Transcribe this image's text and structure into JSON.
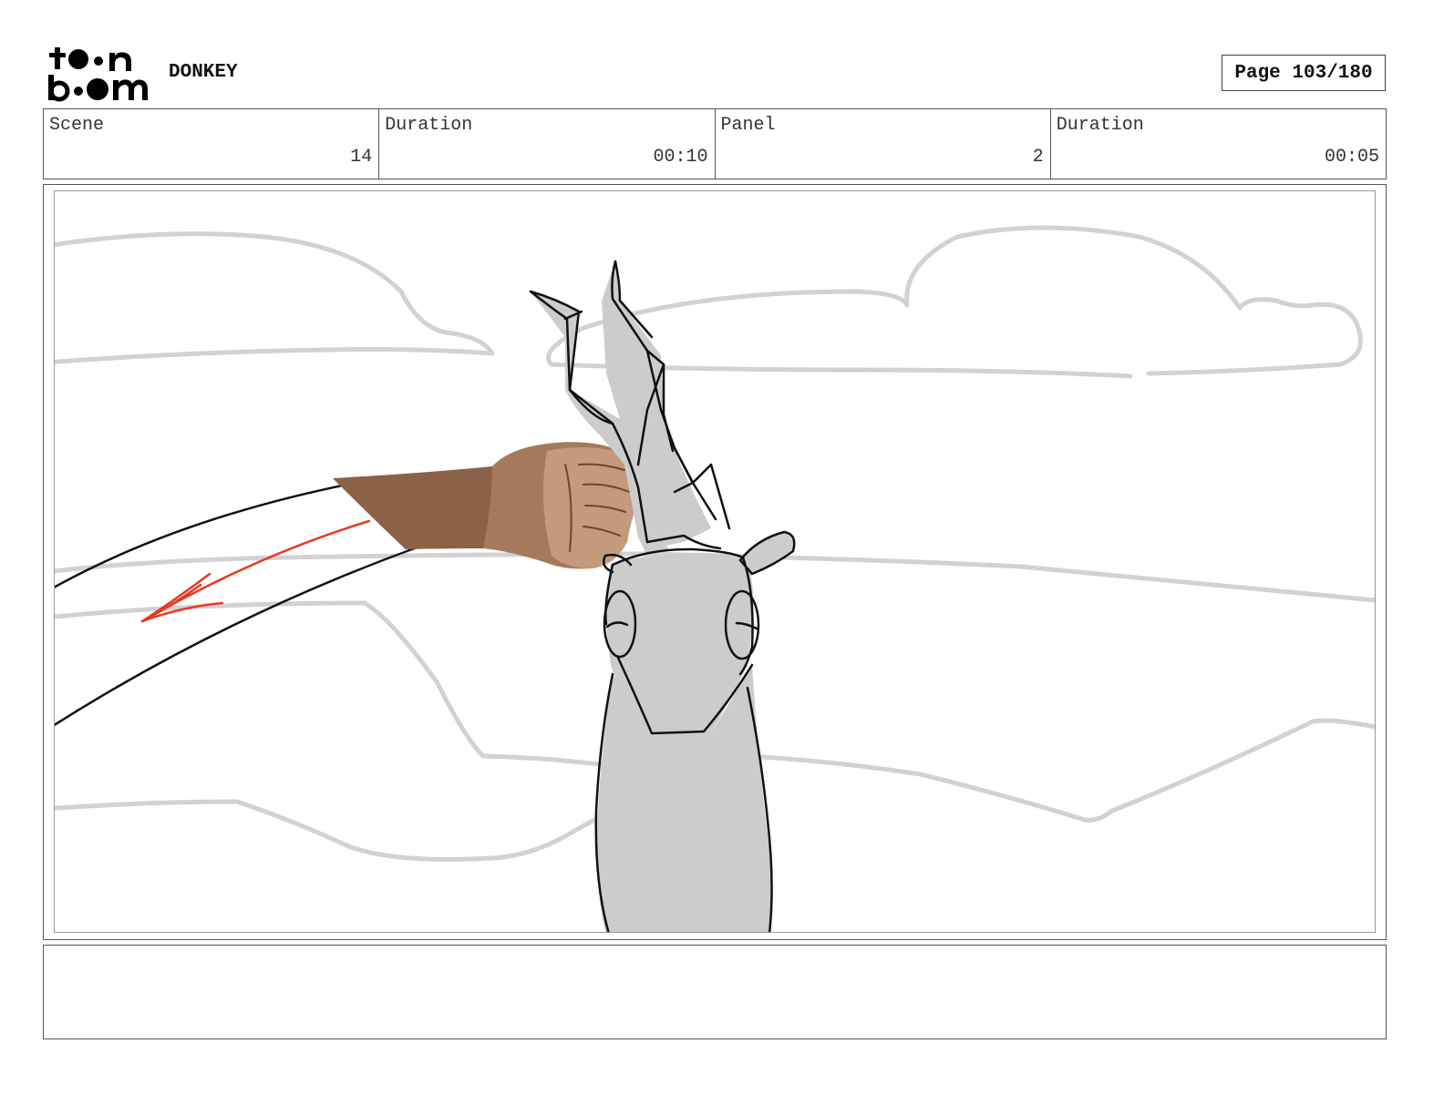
{
  "header": {
    "logo_text": "toon boom",
    "project_title": "DONKEY",
    "page_label": "Page 103/180"
  },
  "info": {
    "scene_label": "Scene",
    "scene_value": "14",
    "scene_duration_label": "Duration",
    "scene_duration_value": "00:10",
    "panel_label": "Panel",
    "panel_value": "2",
    "panel_duration_label": "Duration",
    "panel_duration_value": "00:05"
  },
  "panel": {
    "action_arrow_color": "#e8391f",
    "sketch_fill_color": "#cccccc",
    "background_line_color": "#d2d2d2"
  },
  "notes": {
    "text": ""
  }
}
